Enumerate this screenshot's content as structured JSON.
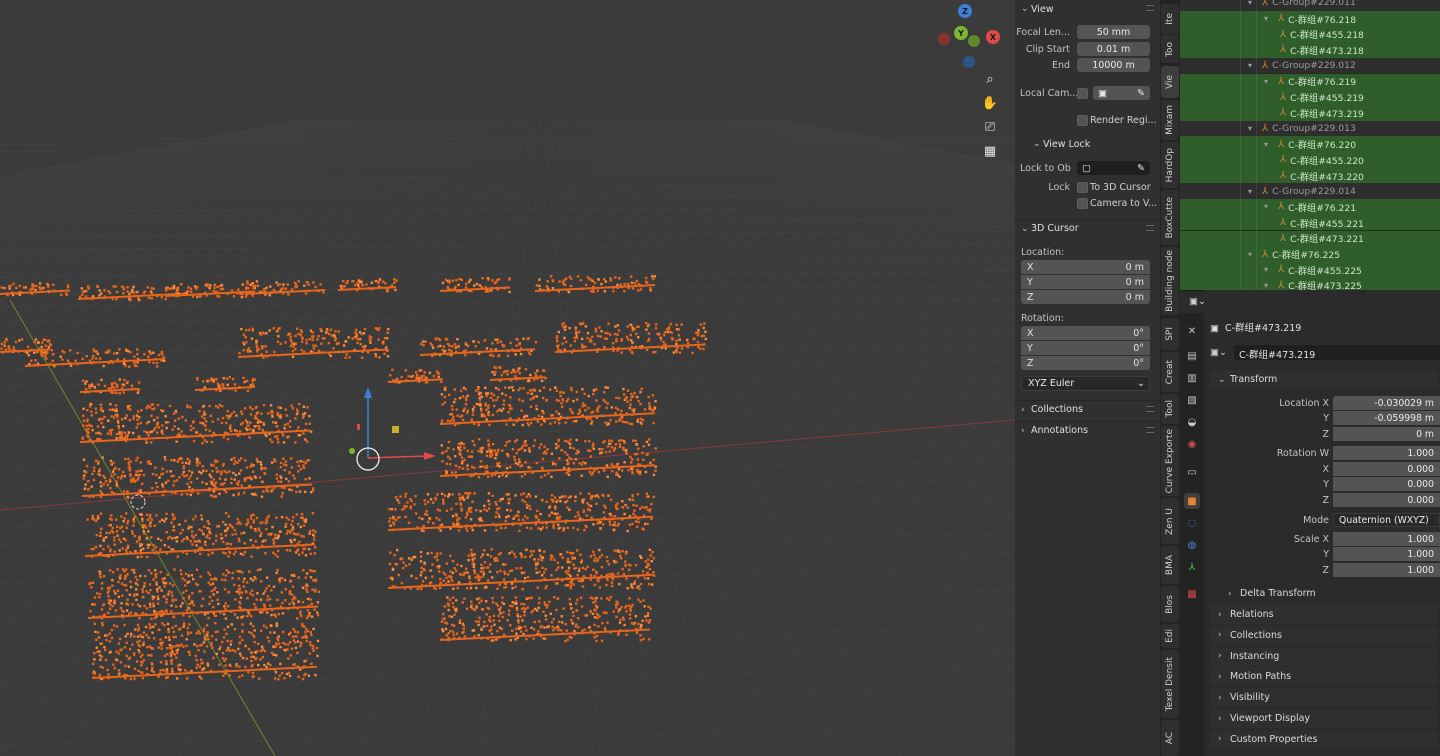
{
  "viewport": {
    "gizmo": {
      "z": "Z",
      "y": "Y",
      "x": "X"
    },
    "nav_icons": [
      "zoom-icon",
      "hand-icon",
      "camera-icon",
      "grid-icon"
    ]
  },
  "npanel": {
    "view": {
      "title": "View",
      "focal_label": "Focal Len...",
      "focal_value": "50 mm",
      "clip_start_label": "Clip Start",
      "clip_start_value": "0.01 m",
      "end_label": "End",
      "end_value": "10000 m",
      "local_camera_label": "Local Cam...",
      "render_region_label": "Render Regi...",
      "view_lock_title": "View Lock",
      "lock_to_ob_label": "Lock to Ob",
      "lock_label": "Lock",
      "to_3d_cursor_label": "To 3D Cursor",
      "camera_to_view_label": "Camera to V..."
    },
    "cursor": {
      "title": "3D Cursor",
      "location_label": "Location:",
      "loc": [
        {
          "axis": "X",
          "value": "0 m"
        },
        {
          "axis": "Y",
          "value": "0 m"
        },
        {
          "axis": "Z",
          "value": "0 m"
        }
      ],
      "rotation_label": "Rotation:",
      "rot": [
        {
          "axis": "X",
          "value": "0°"
        },
        {
          "axis": "Y",
          "value": "0°"
        },
        {
          "axis": "Z",
          "value": "0°"
        }
      ],
      "mode": "XYZ Euler"
    },
    "collections": "Collections",
    "annotations": "Annotations"
  },
  "vtabs": [
    "Ite",
    "Too",
    "Vie",
    "Mixam",
    "HardOp",
    "BoxCutte",
    "Building node",
    "SPI",
    "Creat",
    "Tool",
    "Curve Exporte",
    "Zen U",
    "BMA",
    "Blos",
    "Edi",
    "Texel Densit",
    "AC"
  ],
  "outliner": {
    "rows": [
      {
        "text": "C-Group#229.011",
        "indent": 3,
        "type": "grp"
      },
      {
        "text": "C-群组#76.218",
        "indent": 4,
        "type": "sel"
      },
      {
        "text": "C-群组#455.218",
        "indent": 5,
        "type": "sel"
      },
      {
        "text": "C-群组#473.218",
        "indent": 5,
        "type": "sel"
      },
      {
        "text": "C-Group#229.012",
        "indent": 3,
        "type": "grp"
      },
      {
        "text": "C-群组#76.219",
        "indent": 4,
        "type": "sel"
      },
      {
        "text": "C-群组#455.219",
        "indent": 5,
        "type": "sel"
      },
      {
        "text": "C-群组#473.219",
        "indent": 5,
        "type": "sel"
      },
      {
        "text": "C-Group#229.013",
        "indent": 3,
        "type": "grp"
      },
      {
        "text": "C-群组#76.220",
        "indent": 4,
        "type": "sel"
      },
      {
        "text": "C-群组#455.220",
        "indent": 5,
        "type": "sel"
      },
      {
        "text": "C-群组#473.220",
        "indent": 5,
        "type": "sel"
      },
      {
        "text": "C-Group#229.014",
        "indent": 3,
        "type": "grp"
      },
      {
        "text": "C-群组#76.221",
        "indent": 4,
        "type": "sel"
      },
      {
        "text": "C-群组#455.221",
        "indent": 5,
        "type": "sel"
      },
      {
        "text": "C-群组#473.221",
        "indent": 5,
        "type": "sel"
      },
      {
        "text": "C-群组#76.225",
        "indent": 3,
        "type": "sel"
      },
      {
        "text": "C-群组#455.225",
        "indent": 4,
        "type": "sel"
      },
      {
        "text": "C-群组#473.225",
        "indent": 4,
        "type": "sel"
      }
    ]
  },
  "props": {
    "object_name": "C-群组#473.219",
    "data_name": "C-群组#473.219",
    "transform_title": "Transform",
    "location_x_label": "Location X",
    "location_x": "-0.030029 m",
    "location_y_label": "Y",
    "location_y": "-0.059998 m",
    "location_z_label": "Z",
    "location_z": "0 m",
    "rotation_w_label": "Rotation W",
    "rotation_w": "1.000",
    "rotation_x_label": "X",
    "rotation_x": "0.000",
    "rotation_y_label": "Y",
    "rotation_y": "0.000",
    "rotation_z_label": "Z",
    "rotation_z": "0.000",
    "mode_label": "Mode",
    "mode_value": "Quaternion (WXYZ)",
    "scale_x_label": "Scale X",
    "scale_x": "1.000",
    "scale_y_label": "Y",
    "scale_y": "1.000",
    "scale_z_label": "Z",
    "scale_z": "1.000",
    "delta_transform": "Delta Transform",
    "sections": [
      "Relations",
      "Collections",
      "Instancing",
      "Motion Paths",
      "Visibility",
      "Viewport Display",
      "Custom Properties"
    ]
  },
  "colors": {
    "accent_orange": "#e8651c",
    "outliner_selected": "#2f5e2b",
    "axis_x": "#e04a4a",
    "axis_y": "#7bb82f",
    "axis_z": "#3b7fd6"
  }
}
